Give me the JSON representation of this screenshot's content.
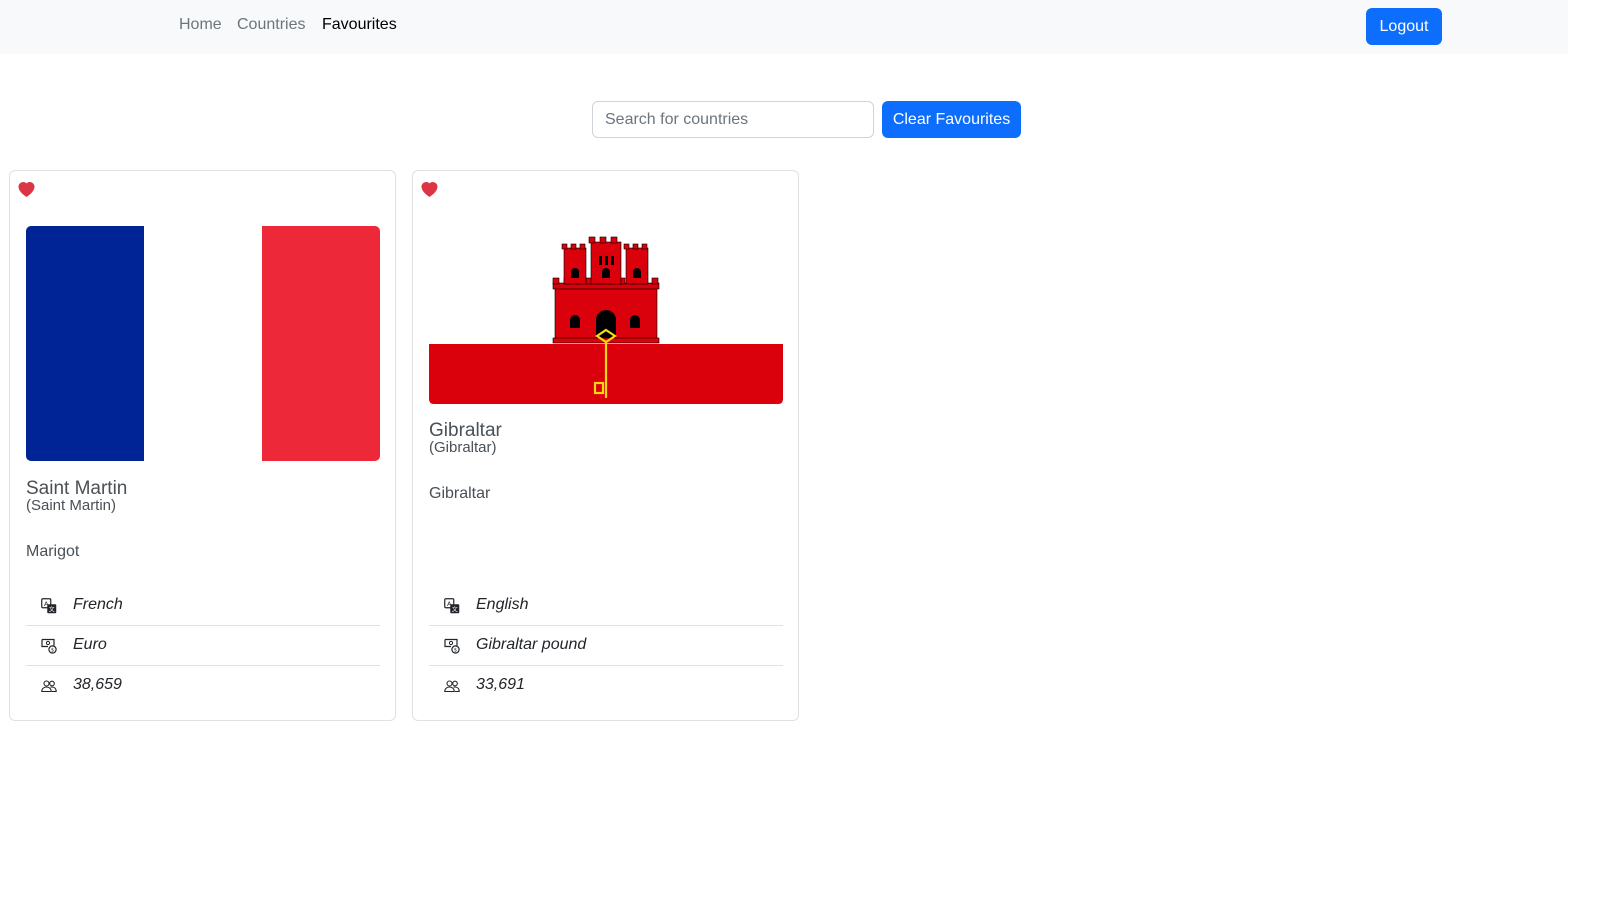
{
  "nav": {
    "links": [
      "Home",
      "Countries",
      "Favourites"
    ],
    "active": "Favourites",
    "logout_label": "Logout"
  },
  "search": {
    "placeholder": "Search for countries",
    "value": "",
    "clear_label": "Clear Favourites"
  },
  "colors": {
    "primary": "#0d6efd",
    "heart": "#dc3545"
  },
  "cards": [
    {
      "name": "Saint Martin",
      "native": "(Saint Martin)",
      "capital": "Marigot",
      "flag": "french-tricolour-flag",
      "favourite": true,
      "language": "French",
      "currency": "Euro",
      "population": "38,659"
    },
    {
      "name": "Gibraltar",
      "native": "(Gibraltar)",
      "capital": "Gibraltar",
      "flag": "gibraltar-flag",
      "favourite": true,
      "language": "English",
      "currency": "Gibraltar pound",
      "population": "33,691"
    }
  ],
  "icons": {
    "favourite": "heart-icon",
    "language": "translate-icon",
    "currency": "cash-coin-icon",
    "population": "people-icon"
  }
}
